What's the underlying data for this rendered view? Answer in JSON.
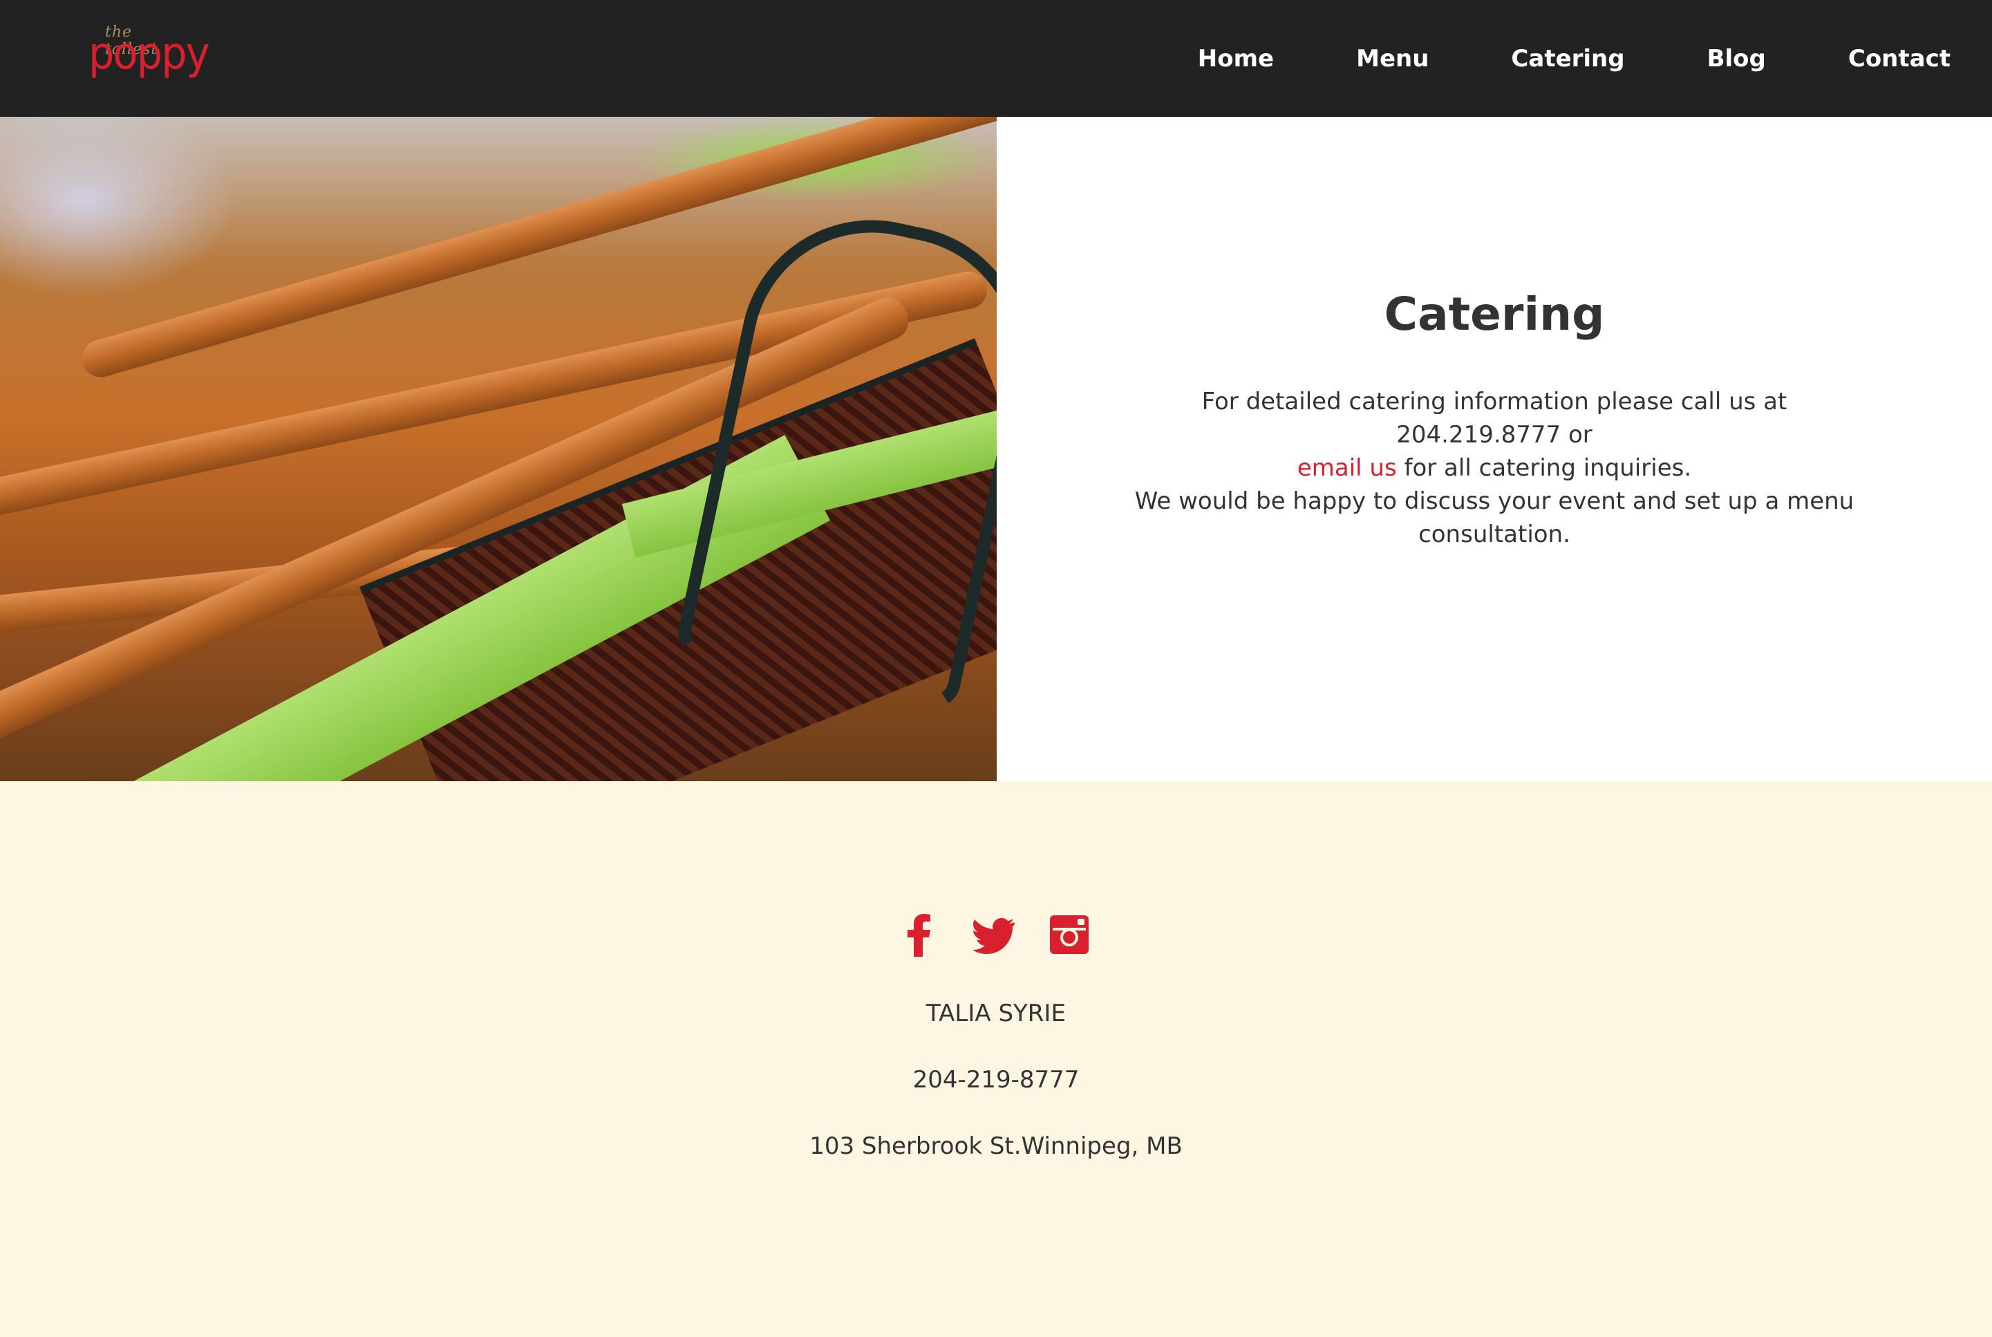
{
  "header": {
    "logo_small": "the tallest",
    "logo_main": "poppy",
    "nav": [
      "Home",
      "Menu",
      "Catering",
      "Blog",
      "Contact"
    ]
  },
  "catering": {
    "title": "Catering",
    "para_1": "For detailed catering information please call us at 204.219.8777 or",
    "link": "email us",
    "para_2": " for all catering inquiries.",
    "para_3": "We would be happy to discuss your event and set up a menu consultation."
  },
  "footer": {
    "social_icons": [
      "facebook-icon",
      "twitter-icon",
      "instagram-icon"
    ],
    "name": "TALIA SYRIE",
    "phone": "204-219-8777",
    "address": "103 Sherbrook St.Winnipeg, MB"
  },
  "colors": {
    "header_bg": "#222222",
    "accent": "#d8202f",
    "footer_bg": "#fdf6e3",
    "text": "#333333"
  }
}
